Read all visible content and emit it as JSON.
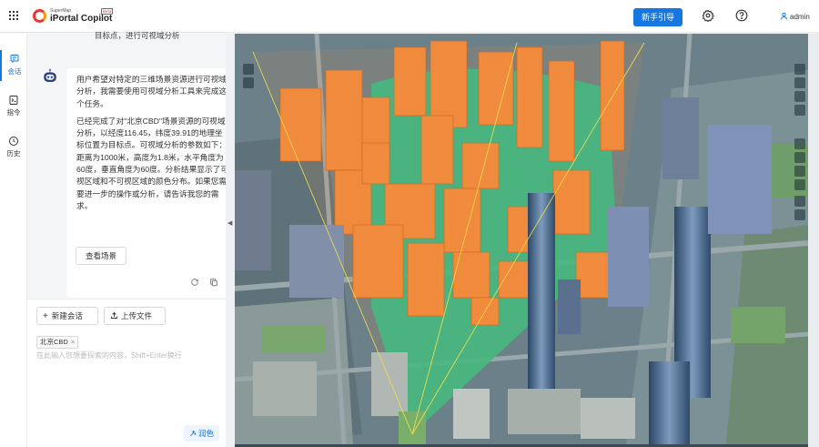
{
  "header": {
    "logo_small": "SuperMap",
    "logo_name": "iPortal Copilot",
    "logo_badge": "Beta",
    "guide_button": "新手引导",
    "settings_icon": "gear-icon",
    "help_icon": "help-icon",
    "user_name": "admin"
  },
  "rail": {
    "items": [
      {
        "label": "会话",
        "icon": "chat-icon",
        "active": true
      },
      {
        "label": "指令",
        "icon": "command-icon",
        "active": false
      },
      {
        "label": "历史",
        "icon": "history-icon",
        "active": false
      }
    ]
  },
  "chat": {
    "top_fragment": "目标点，进行可视域分析",
    "assistant_message": {
      "paragraph_1": "用户希望对特定的三维场景资源进行可视域分析，我需要使用可视域分析工具来完成这个任务。",
      "paragraph_2": "已经完成了对\"北京CBD\"场景资源的可视域分析，以经度116.45，纬度39.91的地理坐标位置为目标点。可视域分析的参数如下：距离为1000米，高度为1.8米，水平角度为60度，垂直角度为60度。分析结果显示了可视区域和不可视区域的颜色分布。如果您需要进一步的操作或分析，请告诉我您的需求。",
      "view_scene_button": "查看场景"
    }
  },
  "input": {
    "new_chat_button": "新建会话",
    "upload_button": "上传文件",
    "context_tag": "北京CBD",
    "placeholder": "在此输入您想要探索的内容，Shift+Enter换行",
    "polish_button": "润色"
  },
  "colors": {
    "accent": "#1677e0",
    "visible_area": "#2fbf8a",
    "invisible_buildings": "#f08a3c"
  }
}
